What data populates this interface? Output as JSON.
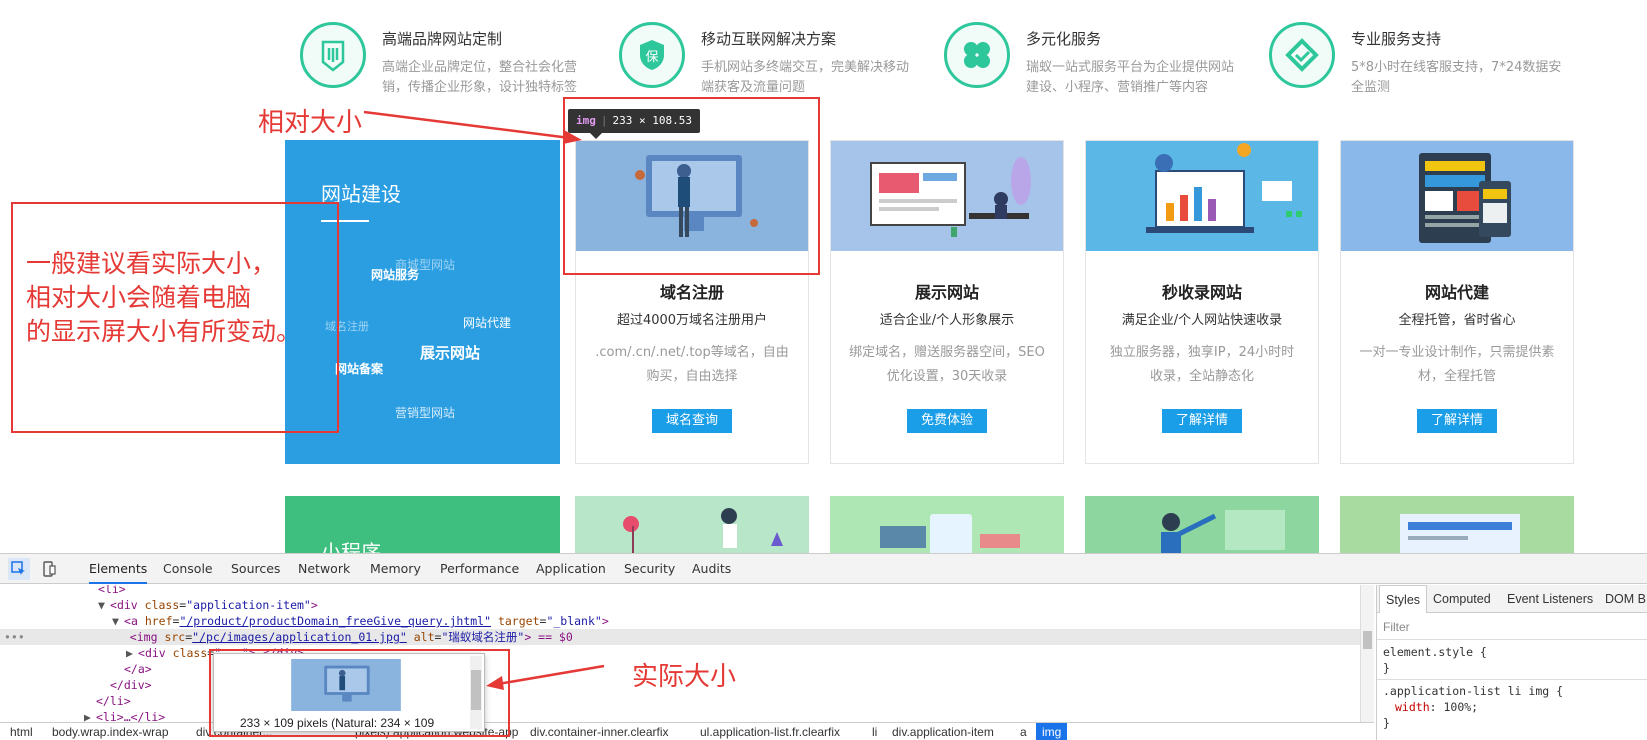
{
  "features": [
    {
      "title": "高端品牌网站定制",
      "desc": "高端企业品牌定位，整合社会化营销，传播企业形象，设计独特标签",
      "icon": "brand-shield-icon"
    },
    {
      "title": "移动互联网解决方案",
      "desc": "手机网站多终端交互，完美解决移动端获客及流量问题",
      "icon": "bao-shield-icon",
      "icon_char": "保"
    },
    {
      "title": "多元化服务",
      "desc": "瑞蚁一站式服务平台为企业提供网站建设、小程序、营销推广等内容",
      "icon": "clover-icon"
    },
    {
      "title": "专业服务支持",
      "desc": "5*8小时在线客服支持，7*24数据安全监测",
      "icon": "diamond-check-icon"
    }
  ],
  "blue_panel": {
    "title": "网站建设",
    "cloud": [
      "商城型网站",
      "网站服务",
      "域名注册",
      "网站代建",
      "展示网站",
      "网站备案",
      "营销型网站"
    ]
  },
  "tiles": [
    {
      "title": "域名注册",
      "sub": "超过4000万域名注册用户",
      "desc": ".com/.cn/.net/.top等域名，自由购买，自由选择",
      "button": "域名查询"
    },
    {
      "title": "展示网站",
      "sub": "适合企业/个人形象展示",
      "desc": "绑定域名，赠送服务器空间，SEO优化设置，30天收录",
      "button": "免费体验"
    },
    {
      "title": "秒收录网站",
      "sub": "满足企业/个人网站快速收录",
      "desc": "独立服务器，独享IP，24小时时收录，全站静态化",
      "button": "了解详情"
    },
    {
      "title": "网站代建",
      "sub": "全程托管，省时省心",
      "desc": "一对一专业设计制作，只需提供素材，全程托管",
      "button": "了解详情"
    }
  ],
  "green_panel": {
    "title": "小程序"
  },
  "annotations": {
    "relative_size": "相对大小",
    "note_line1": "一般建议看实际大小，",
    "note_line2": "相对大小会随着电脑",
    "note_line3": "的显示屏大小有所变动。",
    "actual_size": "实际大小"
  },
  "tooltip": {
    "tag": "img",
    "size": "233 × 108.53"
  },
  "devtools": {
    "tabs": [
      "Elements",
      "Console",
      "Sources",
      "Network",
      "Memory",
      "Performance",
      "Application",
      "Security",
      "Audits"
    ],
    "active_tab": "Elements",
    "dom_lines": [
      {
        "indent": 0,
        "text": "<li>"
      },
      {
        "indent": 1,
        "arrow": "▼",
        "tag": "div",
        "attr": "class",
        "val": "\"application-item\"",
        "end": ">"
      },
      {
        "indent": 2,
        "arrow": "▼",
        "tag": "a",
        "attr": "href",
        "val": "\"/product/productDomain_freeGive_query.jhtml\"",
        "attr2": "target",
        "val2": "\"_blank\"",
        "end": ">"
      },
      {
        "indent": 3,
        "tag": "img",
        "attr": "src",
        "val": "\"/pc/images/application_01.jpg\"",
        "attr2": "alt",
        "val2": "\"瑞蚁域名注册\"",
        "end": "> == $0",
        "selected": true
      },
      {
        "indent": 2,
        "arrow": "▶",
        "tag": "div",
        "attr": "class",
        "val": "\"...\"",
        "end": ">…</div>"
      },
      {
        "indent": 2,
        "text": "</a>"
      },
      {
        "indent": 1,
        "text": "</div>"
      },
      {
        "indent": 0,
        "text": "</li>"
      },
      {
        "indent": 0,
        "arrow": "▶",
        "text": "<li>…</li>"
      }
    ],
    "styles_tabs": [
      "Styles",
      "Computed",
      "Event Listeners",
      "DOM B"
    ],
    "filter_placeholder": "Filter",
    "rule1_selector": "element.style {",
    "rule1_close": "}",
    "rule2_selector": ".application-list li img {",
    "rule2_prop": "width",
    "rule2_value": "100%;",
    "rule2_close": "}",
    "breadcrumbs": [
      "html",
      "body.wrap.index-wrap",
      "div.container...",
      "pixels) application.website-app",
      "div.container-inner.clearfix",
      "ul.application-list.fr.clearfix",
      "li",
      "div.application-item",
      "a",
      "img"
    ],
    "preview_text": "233 × 109 pixels (Natural: 234 × 109"
  },
  "colors": {
    "accent_green": "#2ec79b",
    "panel_blue": "#2b9ee2",
    "panel_green": "#3fbf7f",
    "button_blue": "#1a9ee8",
    "annotation_red": "#e53935"
  }
}
